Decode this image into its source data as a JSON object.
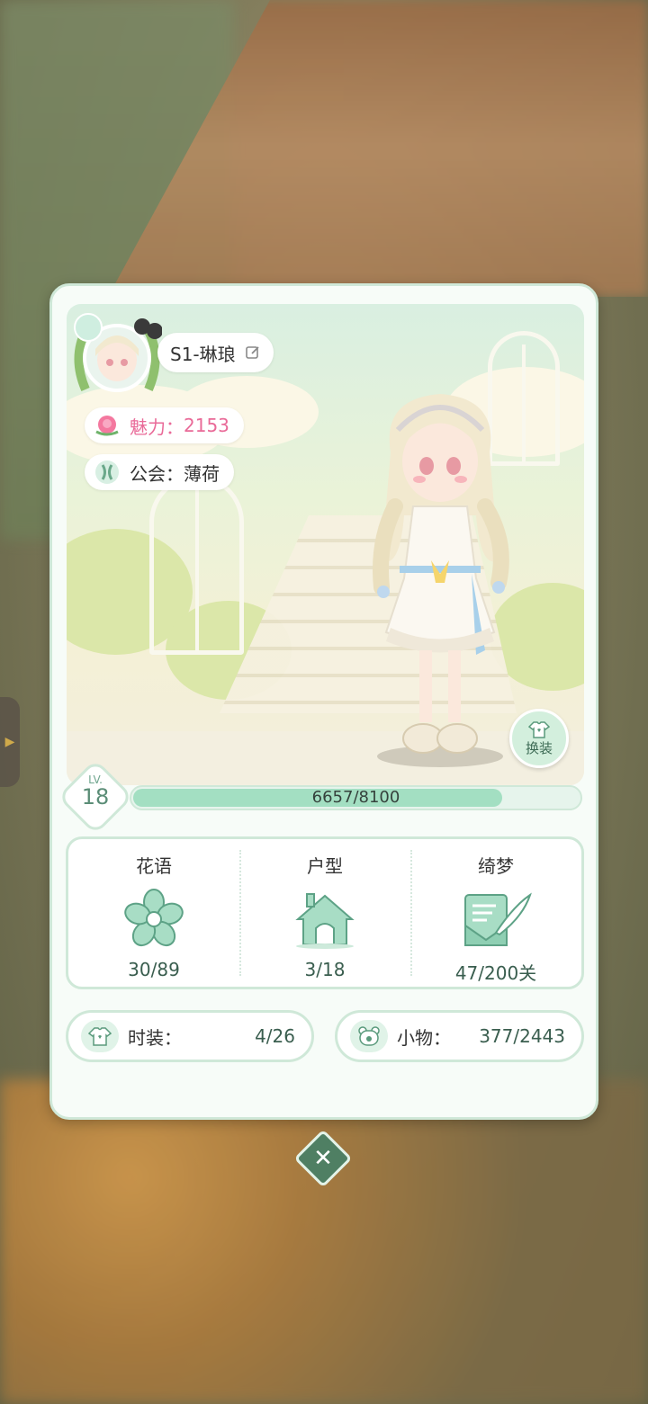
{
  "profile": {
    "name": "S1-琳琅",
    "charm_label": "魅力：",
    "charm_value": "2153",
    "guild_label": "公会：",
    "guild_value": "薄荷"
  },
  "dress_button": {
    "label": "换装"
  },
  "level": {
    "prefix": "LV.",
    "value": "18"
  },
  "xp": {
    "current": 6657,
    "max": 8100,
    "text": "6657/8100"
  },
  "stats": [
    {
      "title": "花语",
      "icon": "flower-icon",
      "value": "30/89"
    },
    {
      "title": "户型",
      "icon": "house-icon",
      "value": "3/18"
    },
    {
      "title": "绮梦",
      "icon": "quill-letter-icon",
      "value": "47/200关"
    }
  ],
  "collections": {
    "fashion_label": "时装：",
    "fashion_value": "4/26",
    "items_label": "小物：",
    "items_value": "377/2443"
  },
  "colors": {
    "accent": "#5b8d77",
    "charm": "#e96a98",
    "panel_border": "#cfe8d8",
    "xp_fill": "#a3dfc2"
  }
}
